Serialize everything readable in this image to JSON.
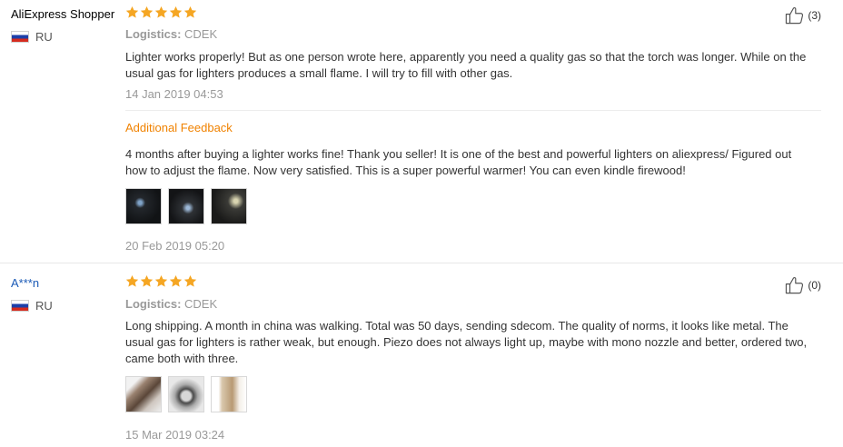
{
  "colors": {
    "star": "#f5a623",
    "accent_orange": "#f08200",
    "link_blue": "#1a5ab6",
    "muted": "#999999"
  },
  "reviews": [
    {
      "user": "AliExpress Shopper",
      "country": "RU",
      "rating": 5,
      "logistics_label": "Logistics:",
      "logistics_value": "CDEK",
      "text": "Lighter works properly! But as one person wrote here, apparently you need a quality gas so that the torch was longer. While on the usual gas for lighters produces a small flame. I will try to fill with other gas.",
      "date": "14 Jan 2019 04:53",
      "helpful_count": "(3)",
      "additional": {
        "label": "Additional Feedback",
        "text": "4 months after buying a lighter works fine! Thank you seller! It is one of the best and powerful lighters on aliexpress/ Figured out how to adjust the flame. Now very satisfied. This is a super powerful warmer! You can even kindle firewood!",
        "date": "20 Feb 2019 05:20",
        "photos": 3
      }
    },
    {
      "user": "A***n",
      "country": "RU",
      "rating": 5,
      "logistics_label": "Logistics:",
      "logistics_value": "CDEK",
      "text": "Long shipping. A month in china was walking. Total was 50 days, sending sdecom. The quality of norms, it looks like metal. The usual gas for lighters is rather weak, but enough. Piezo does not always light up, maybe with mono nozzle and better, ordered two, came both with three.",
      "date": "15 Mar 2019 03:24",
      "helpful_count": "(0)",
      "photos": 3
    }
  ]
}
